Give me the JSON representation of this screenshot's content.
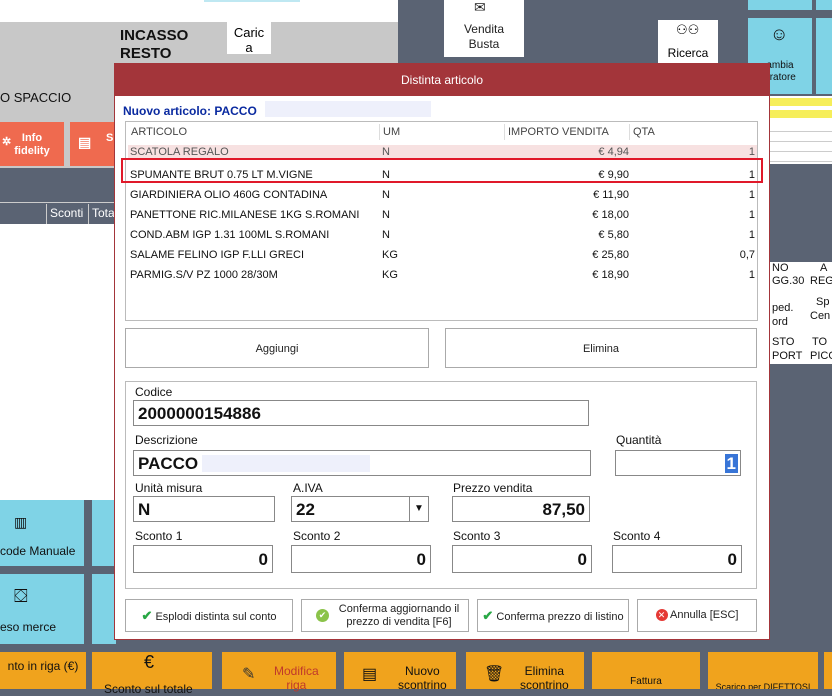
{
  "background": {
    "incasso_line1": "INCASSO",
    "incasso_line2": "RESTO",
    "carica_line1": "Caric",
    "carica_line2": "a",
    "spaccio": "O SPACCIO",
    "info_fidelity_line1": "Info",
    "info_fidelity_line2": "fidelity",
    "cut_button": "S",
    "col_sconti": "Sconti",
    "col_tota": "Tota",
    "vendita_busta_line1": "Vendita",
    "vendita_busta_line2": "Busta",
    "ricerca": "Ricerca",
    "cambia_line1": "ambia",
    "cambia_line2": "eratore",
    "barcode_manuale": "code Manuale",
    "reso_merce": "eso merce",
    "sconto_in_riga": "nto in riga (€)",
    "sconto_sul_totale": "Sconto sul totale",
    "modifica_riga_line1": "Modifica",
    "modifica_riga_line2": "riga",
    "nuovo_scontrino_line1": "Nuovo",
    "nuovo_scontrino_line2": "scontrino",
    "elimina_scontrino_line1": "Elimina",
    "elimina_scontrino_line2": "scontrino",
    "fattura": "Fattura",
    "scarico": "Scarico per DIFETTOSI",
    "grid_right": [
      "NO",
      "A",
      "GG.30",
      "REG",
      "ped.",
      "Sp",
      "ord",
      "Cen",
      "STO",
      "TO",
      "PORT",
      "PICO"
    ]
  },
  "dialog": {
    "title": "Distinta articolo",
    "nuovo_articolo": "Nuovo articolo: PACCO",
    "columns": [
      "ARTICOLO",
      "UM",
      "IMPORTO VENDITA",
      "QTA"
    ],
    "rows": [
      {
        "articolo": "SCATOLA REGALO",
        "um": "N",
        "importo": "€ 4,94",
        "qta": "1"
      },
      {
        "articolo": "SPUMANTE BRUT 0.75 LT M.VIGNE",
        "um": "N",
        "importo": "€ 9,90",
        "qta": "1"
      },
      {
        "articolo": "GIARDINIERA OLIO 460G CONTADINA",
        "um": "N",
        "importo": "€ 11,90",
        "qta": "1"
      },
      {
        "articolo": "PANETTONE RIC.MILANESE 1KG S.ROMANI",
        "um": "N",
        "importo": "€ 18,00",
        "qta": "1"
      },
      {
        "articolo": "COND.ABM IGP 1.31 100ML S.ROMANI",
        "um": "N",
        "importo": "€ 5,80",
        "qta": "1"
      },
      {
        "articolo": "SALAME FELINO IGP F.LLI GRECI",
        "um": "KG",
        "importo": "€ 25,80",
        "qta": "0,7"
      },
      {
        "articolo": "PARMIG.S/V PZ 1000 28/30M",
        "um": "KG",
        "importo": "€ 18,90",
        "qta": "1"
      }
    ],
    "aggiungi": "Aggiungi",
    "elimina": "Elimina",
    "codice_label": "Codice",
    "codice_value": "2000000154886",
    "descrizione_label": "Descrizione",
    "descrizione_value": "PACCO",
    "quantita_label": "Quantità",
    "quantita_value": "1",
    "unita_label": "Unità misura",
    "unita_value": "N",
    "aiva_label": "A.IVA",
    "aiva_value": "22",
    "prezzo_label": "Prezzo vendita",
    "prezzo_value": "87,50",
    "sconto1_label": "Sconto 1",
    "sconto1_value": "0",
    "sconto2_label": "Sconto 2",
    "sconto2_value": "0",
    "sconto3_label": "Sconto 3",
    "sconto3_value": "0",
    "sconto4_label": "Sconto 4",
    "sconto4_value": "0",
    "esplodi": "Esplodi distinta sul conto",
    "conferma_agg_line1": "Conferma aggiornando il",
    "conferma_agg_line2": "prezzo di vendita [F6]",
    "conferma_listino": "Conferma prezzo di listino",
    "annulla": "Annulla [ESC]"
  },
  "colors": {
    "dialog_title": "#a3353a",
    "highlight": "#e0192a",
    "accent_orange": "#f0a31d",
    "accent_cyan": "#7fd3e6"
  }
}
